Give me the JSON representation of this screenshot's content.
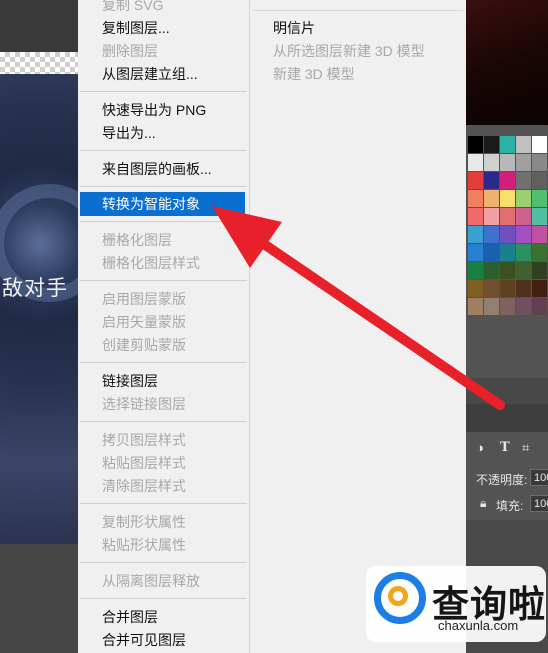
{
  "canvas": {
    "text": "敌对手"
  },
  "context_menu": {
    "items": [
      {
        "label": "复制 SVG",
        "enabled": false
      },
      {
        "label": "复制图层...",
        "enabled": true
      },
      {
        "label": "删除图层",
        "enabled": false
      },
      {
        "label": "从图层建立组...",
        "enabled": true
      },
      {
        "label": "快速导出为 PNG",
        "enabled": true
      },
      {
        "label": "导出为...",
        "enabled": true
      },
      {
        "label": "来自图层的画板...",
        "enabled": true
      },
      {
        "label": "转换为智能对象",
        "enabled": true,
        "highlighted": true
      },
      {
        "label": "栅格化图层",
        "enabled": false
      },
      {
        "label": "栅格化图层样式",
        "enabled": false
      },
      {
        "label": "启用图层蒙版",
        "enabled": false
      },
      {
        "label": "启用矢量蒙版",
        "enabled": false
      },
      {
        "label": "创建剪贴蒙版",
        "enabled": false
      },
      {
        "label": "链接图层",
        "enabled": true
      },
      {
        "label": "选择链接图层",
        "enabled": false
      },
      {
        "label": "拷贝图层样式",
        "enabled": false
      },
      {
        "label": "粘贴图层样式",
        "enabled": false
      },
      {
        "label": "清除图层样式",
        "enabled": false
      },
      {
        "label": "复制形状属性",
        "enabled": false
      },
      {
        "label": "粘贴形状属性",
        "enabled": false
      },
      {
        "label": "从隔离图层释放",
        "enabled": false
      },
      {
        "label": "合并图层",
        "enabled": true
      },
      {
        "label": "合并可见图层",
        "enabled": true
      }
    ]
  },
  "submenu": {
    "items": [
      {
        "label": "明信片",
        "enabled": true
      },
      {
        "label": "从所选图层新建 3D 模型",
        "enabled": false
      },
      {
        "label": "新建 3D 模型",
        "enabled": false
      }
    ]
  },
  "layers_panel": {
    "opacity_label": "不透明度:",
    "opacity_value": "100",
    "fill_label": "填充:",
    "fill_value": "100"
  },
  "colors": {
    "highlight": "#0a6fcf",
    "arrow": "#e8202a",
    "menu_bg": "#f0f0f0"
  },
  "watermark": {
    "title": "查询啦",
    "url": "chaxunla.com"
  }
}
